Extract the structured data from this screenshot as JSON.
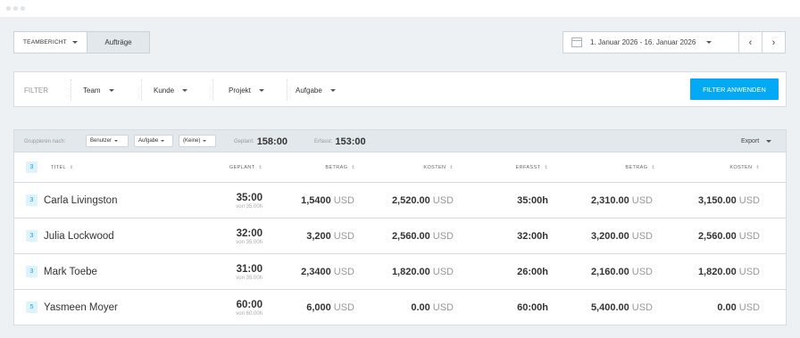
{
  "window_dots": 3,
  "view_tabs": {
    "team_report": "TEAMBERICHT",
    "orders": "Aufträge"
  },
  "date_range": "1. Januar 2026 - 16. Januar 2026",
  "nav": {
    "prev": "‹",
    "next": "›"
  },
  "filters": {
    "label": "FILTER",
    "items": [
      "Team",
      "Kunde",
      "Projekt",
      "Aufgabe"
    ],
    "apply": "FILTER ANWENDEN"
  },
  "grouping": {
    "label": "Gruppieren nach:",
    "options": [
      "Benutzer",
      "Aufgabe",
      "(Keine)"
    ],
    "planned_label": "Geplant:",
    "planned_value": "158:00",
    "tracked_label": "Erfasst:",
    "tracked_value": "153:00",
    "export": "Export"
  },
  "table": {
    "count": "3",
    "headers": [
      "TITEL",
      "GEPLANT",
      "BETRAG",
      "KOSTEN",
      "ERFASST",
      "BETRAG",
      "KOSTEN"
    ],
    "sort_icon": "⇕",
    "currency": "USD",
    "rows": [
      {
        "badge": "3",
        "name": "Carla Livingston",
        "planned": "35:00",
        "planned_of": "von 35:00h",
        "amount1": "1,5400",
        "cost1": "2,520.00",
        "tracked": "35:00h",
        "amount2": "2,310.00",
        "cost2": "3,150.00"
      },
      {
        "badge": "3",
        "name": "Julia Lockwood",
        "planned": "32:00",
        "planned_of": "von 35:00h",
        "amount1": "3,200",
        "cost1": "2,560.00",
        "tracked": "32:00h",
        "amount2": "3,200.00",
        "cost2": "2,560.00"
      },
      {
        "badge": "3",
        "name": "Mark Toebe",
        "planned": "31:00",
        "planned_of": "von 35:00h",
        "amount1": "2,3400",
        "cost1": "1,820.00",
        "tracked": "26:00h",
        "amount2": "2,160.00",
        "cost2": "1,820.00"
      },
      {
        "badge": "5",
        "name": "Yasmeen Moyer",
        "planned": "60:00",
        "planned_of": "von 60:00h",
        "amount1": "6,000",
        "cost1": "0.00",
        "tracked": "60:00h",
        "amount2": "5,400.00",
        "cost2": "0.00"
      }
    ]
  }
}
